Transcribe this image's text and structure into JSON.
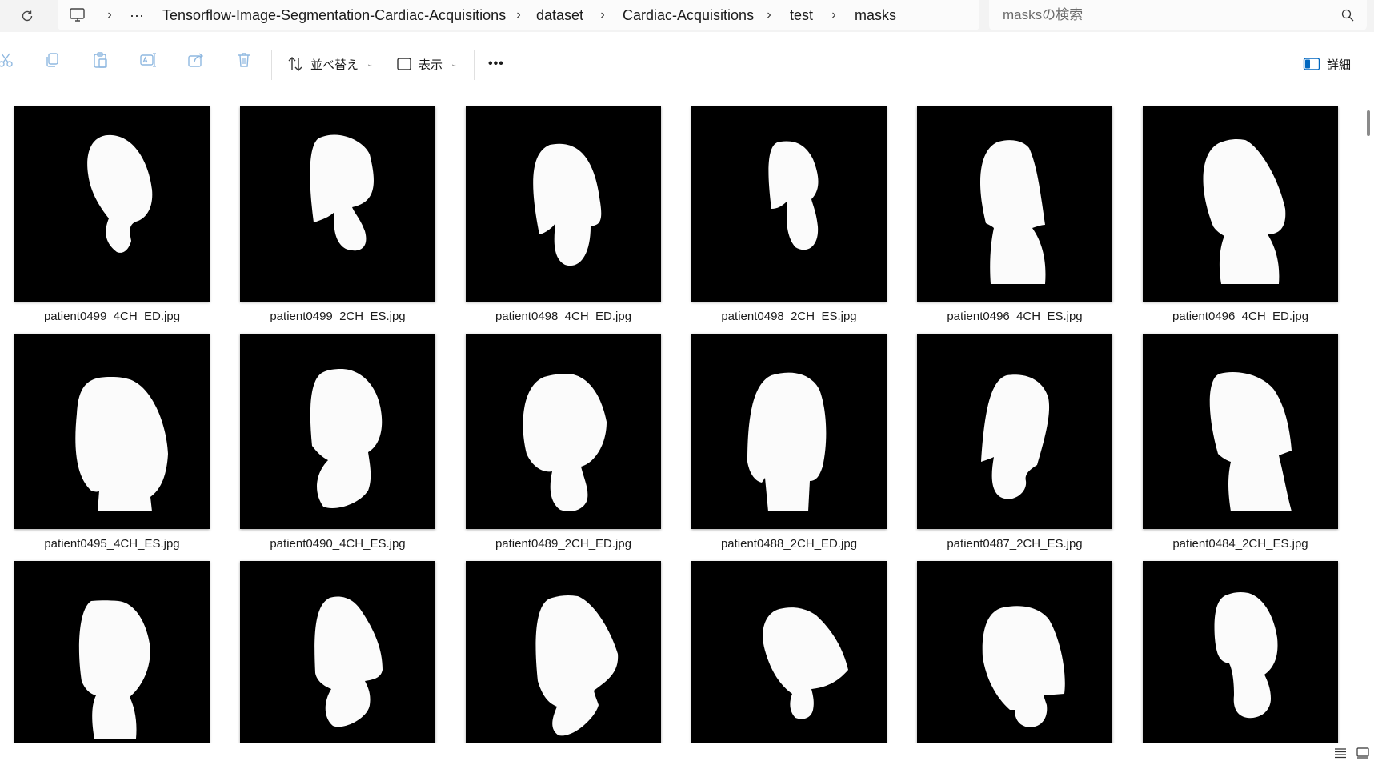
{
  "breadcrumb": {
    "ellipsis": "···",
    "items": [
      "Tensorflow-Image-Segmentation-Cardiac-Acquisitions",
      "dataset",
      "Cardiac-Acquisitions",
      "test",
      "masks"
    ],
    "separator": "›"
  },
  "search": {
    "placeholder": "masksの検索"
  },
  "toolbar": {
    "sort_label": "並べ替え",
    "view_label": "表示",
    "more_label": "•••",
    "details_label": "詳細",
    "icons": [
      "cut-icon",
      "copy-icon",
      "paste-icon",
      "rename-icon",
      "share-icon",
      "delete-icon"
    ]
  },
  "files": [
    {
      "name": "patient0499_4CH_ED.jpg"
    },
    {
      "name": "patient0499_2CH_ES.jpg"
    },
    {
      "name": "patient0498_4CH_ED.jpg"
    },
    {
      "name": "patient0498_2CH_ES.jpg"
    },
    {
      "name": "patient0496_4CH_ES.jpg"
    },
    {
      "name": "patient0496_4CH_ED.jpg"
    },
    {
      "name": "patient0495_4CH_ES.jpg"
    },
    {
      "name": "patient0490_4CH_ES.jpg"
    },
    {
      "name": "patient0489_2CH_ED.jpg"
    },
    {
      "name": "patient0488_2CH_ED.jpg"
    },
    {
      "name": "patient0487_2CH_ES.jpg"
    },
    {
      "name": "patient0484_2CH_ES.jpg"
    },
    {
      "name": ""
    },
    {
      "name": ""
    },
    {
      "name": ""
    },
    {
      "name": ""
    },
    {
      "name": ""
    },
    {
      "name": ""
    }
  ],
  "colors": {
    "accent": "#0067c0",
    "mask_bg": "#000000",
    "mask_fg": "#ffffff"
  }
}
